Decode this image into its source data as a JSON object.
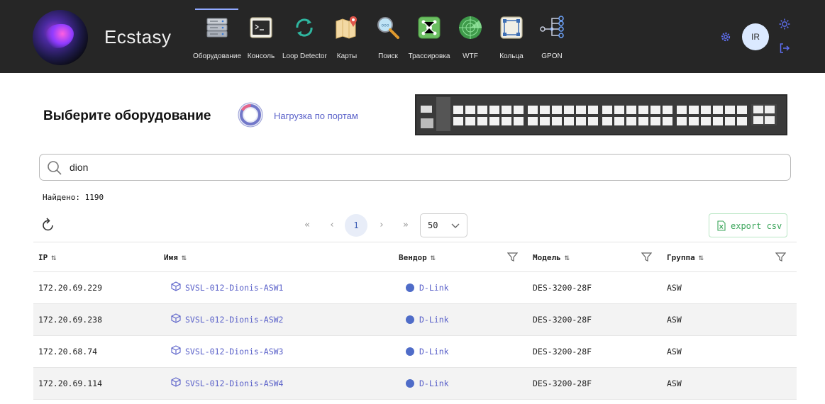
{
  "app": {
    "title": "Ecstasy"
  },
  "nav": [
    {
      "label": "Оборудование",
      "icon": "server-icon",
      "active": true
    },
    {
      "label": "Консоль",
      "icon": "terminal-icon"
    },
    {
      "label": "Loop Detector",
      "icon": "loop-arrows-icon"
    },
    {
      "label": "Карты",
      "icon": "map-pin-icon"
    },
    {
      "label": "Поиск",
      "icon": "magnifier-icon"
    },
    {
      "label": "Трассировка",
      "icon": "trace-network-icon"
    },
    {
      "label": "WTF",
      "icon": "radar-icon"
    },
    {
      "label": "Кольца",
      "icon": "ring-topology-icon"
    },
    {
      "label": "GPON",
      "icon": "gpon-tree-icon"
    }
  ],
  "user": {
    "initials": "IR"
  },
  "page": {
    "title": "Выберите оборудование",
    "load_link": "Нагрузка по портам"
  },
  "search": {
    "value": "dion",
    "placeholder": ""
  },
  "found": {
    "label": "Найдено: 1190"
  },
  "pagination": {
    "current_page": "1",
    "page_size": "50",
    "first": "«",
    "prev": "‹",
    "next": "›",
    "last": "»"
  },
  "export": {
    "label": "export csv",
    "accent": "#3aa55a"
  },
  "table": {
    "columns": [
      "IP",
      "Имя",
      "Вендор",
      "Модель",
      "Группа"
    ],
    "rows": [
      {
        "ip": "172.20.69.229",
        "name": "SVSL-012-Dionis-ASW1",
        "vendor": "D-Link",
        "model": "DES-3200-28F",
        "group": "ASW"
      },
      {
        "ip": "172.20.69.238",
        "name": "SVSL-012-Dionis-ASW2",
        "vendor": "D-Link",
        "model": "DES-3200-28F",
        "group": "ASW"
      },
      {
        "ip": "172.20.68.74",
        "name": "SVSL-012-Dionis-ASW3",
        "vendor": "D-Link",
        "model": "DES-3200-28F",
        "group": "ASW"
      },
      {
        "ip": "172.20.69.114",
        "name": "SVSL-012-Dionis-ASW4",
        "vendor": "D-Link",
        "model": "DES-3200-28F",
        "group": "ASW"
      }
    ]
  },
  "colors": {
    "link": "#5a61c9",
    "header_bg": "#262626",
    "vendor_dot": "#4f6cc8"
  }
}
